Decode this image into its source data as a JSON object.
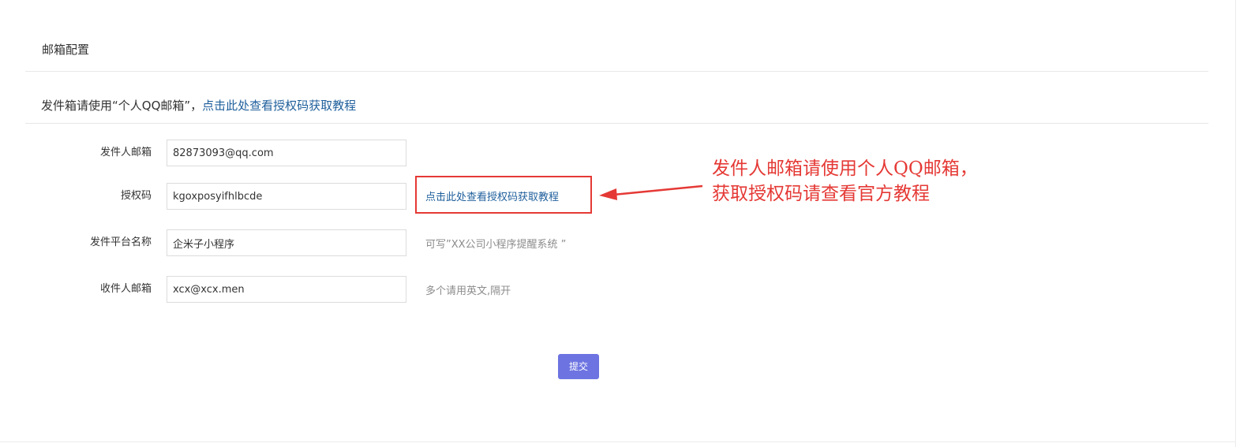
{
  "section": {
    "title": "邮箱配置"
  },
  "notice": {
    "text": "发件箱请使用“个人QQ邮箱”，",
    "link_text": "点击此处查看授权码获取教程"
  },
  "form": {
    "fields": [
      {
        "label": "发件人邮箱",
        "value": "82873093@qq.com",
        "hint": ""
      },
      {
        "label": "授权码",
        "value": "kgoxposyifhlbcde",
        "hint": ""
      },
      {
        "label": "发件平台名称",
        "value": "企米子小程序",
        "hint": "可写”XX公司小程序提醒系统 ”"
      },
      {
        "label": "收件人邮箱",
        "value": "xcx@xcx.men",
        "hint": "多个请用英文,隔开"
      }
    ],
    "auth_code_link": "点击此处查看授权码获取教程",
    "submit_label": "提交"
  },
  "annotation": {
    "line1": "发件人邮箱请使用个人QQ邮箱，",
    "line2": "获取授权码请查看官方教程"
  },
  "colors": {
    "link": "#1f5f9c",
    "accent_button": "#6d74e1",
    "annotation_red": "#e53935"
  }
}
